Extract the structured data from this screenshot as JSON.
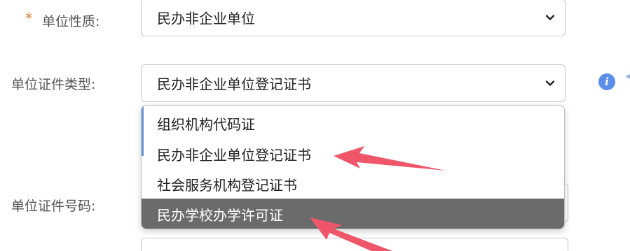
{
  "form": {
    "unit_nature": {
      "required_mark": "*",
      "label": "单位性质:",
      "value": "民办非企业单位"
    },
    "cert_type": {
      "label": "单位证件类型:",
      "value": "民办非企业单位登记证书"
    },
    "cert_number": {
      "label": "单位证件号码:"
    }
  },
  "dropdown": {
    "options": [
      {
        "label": "组织机构代码证"
      },
      {
        "label": "民办非企业单位登记证书"
      },
      {
        "label": "社会服务机构登记证书"
      },
      {
        "label": "民办学校办学许可证"
      }
    ],
    "highlighted_index": 3
  },
  "info_icon": {
    "glyph": "i"
  },
  "colors": {
    "highlight_bg": "#6b6b6b",
    "arrow": "#f0566a",
    "info_icon": "#5b8ee6",
    "required_star": "#e87d2d"
  },
  "icons": [
    "chevron-down-icon",
    "info-icon",
    "arrow-annotation"
  ]
}
